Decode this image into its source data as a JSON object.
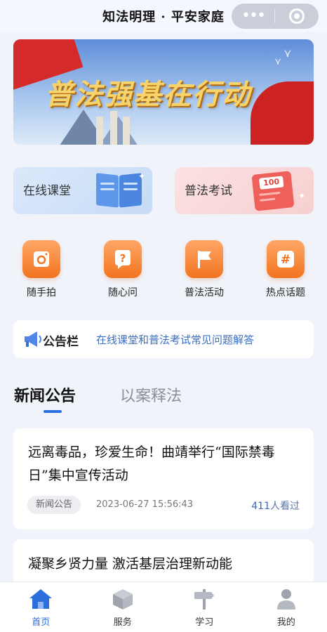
{
  "header": {
    "title": "知法明理 · 平安家庭",
    "more_glyph": "•••"
  },
  "banner": {
    "slogan": "普法强基在行动"
  },
  "quick_cards": [
    {
      "label": "在线课堂",
      "icon": "book-icon"
    },
    {
      "label": "普法考试",
      "icon": "exam-paper-icon",
      "score": "100"
    }
  ],
  "grid": [
    {
      "label": "随手拍",
      "icon": "camera-icon"
    },
    {
      "label": "随心问",
      "icon": "question-icon"
    },
    {
      "label": "普法活动",
      "icon": "flag-icon"
    },
    {
      "label": "热点话题",
      "icon": "hashtag-icon"
    }
  ],
  "notice": {
    "title": "公告栏",
    "text": "在线课堂和普法考试常见问题解答"
  },
  "tabs": [
    {
      "label": "新闻公告",
      "active": true
    },
    {
      "label": "以案释法",
      "active": false
    }
  ],
  "news": [
    {
      "title": "远离毒品，珍爱生命！曲靖举行“国际禁毒日”集中宣传活动",
      "tag": "新闻公告",
      "time": "2023-06-27 15:56:43",
      "views_num": "411",
      "views_suffix": "人看过"
    },
    {
      "title": "凝聚乡贤力量 激活基层治理新动能"
    }
  ],
  "bottom_nav": [
    {
      "label": "首页",
      "icon": "home-icon",
      "active": true
    },
    {
      "label": "服务",
      "icon": "box-icon",
      "active": false
    },
    {
      "label": "学习",
      "icon": "signpost-icon",
      "active": false
    },
    {
      "label": "我的",
      "icon": "user-icon",
      "active": false
    }
  ],
  "colors": {
    "accent_blue": "#2a6fdc",
    "orange": "#f2741f",
    "background": "#f0f3fa"
  }
}
